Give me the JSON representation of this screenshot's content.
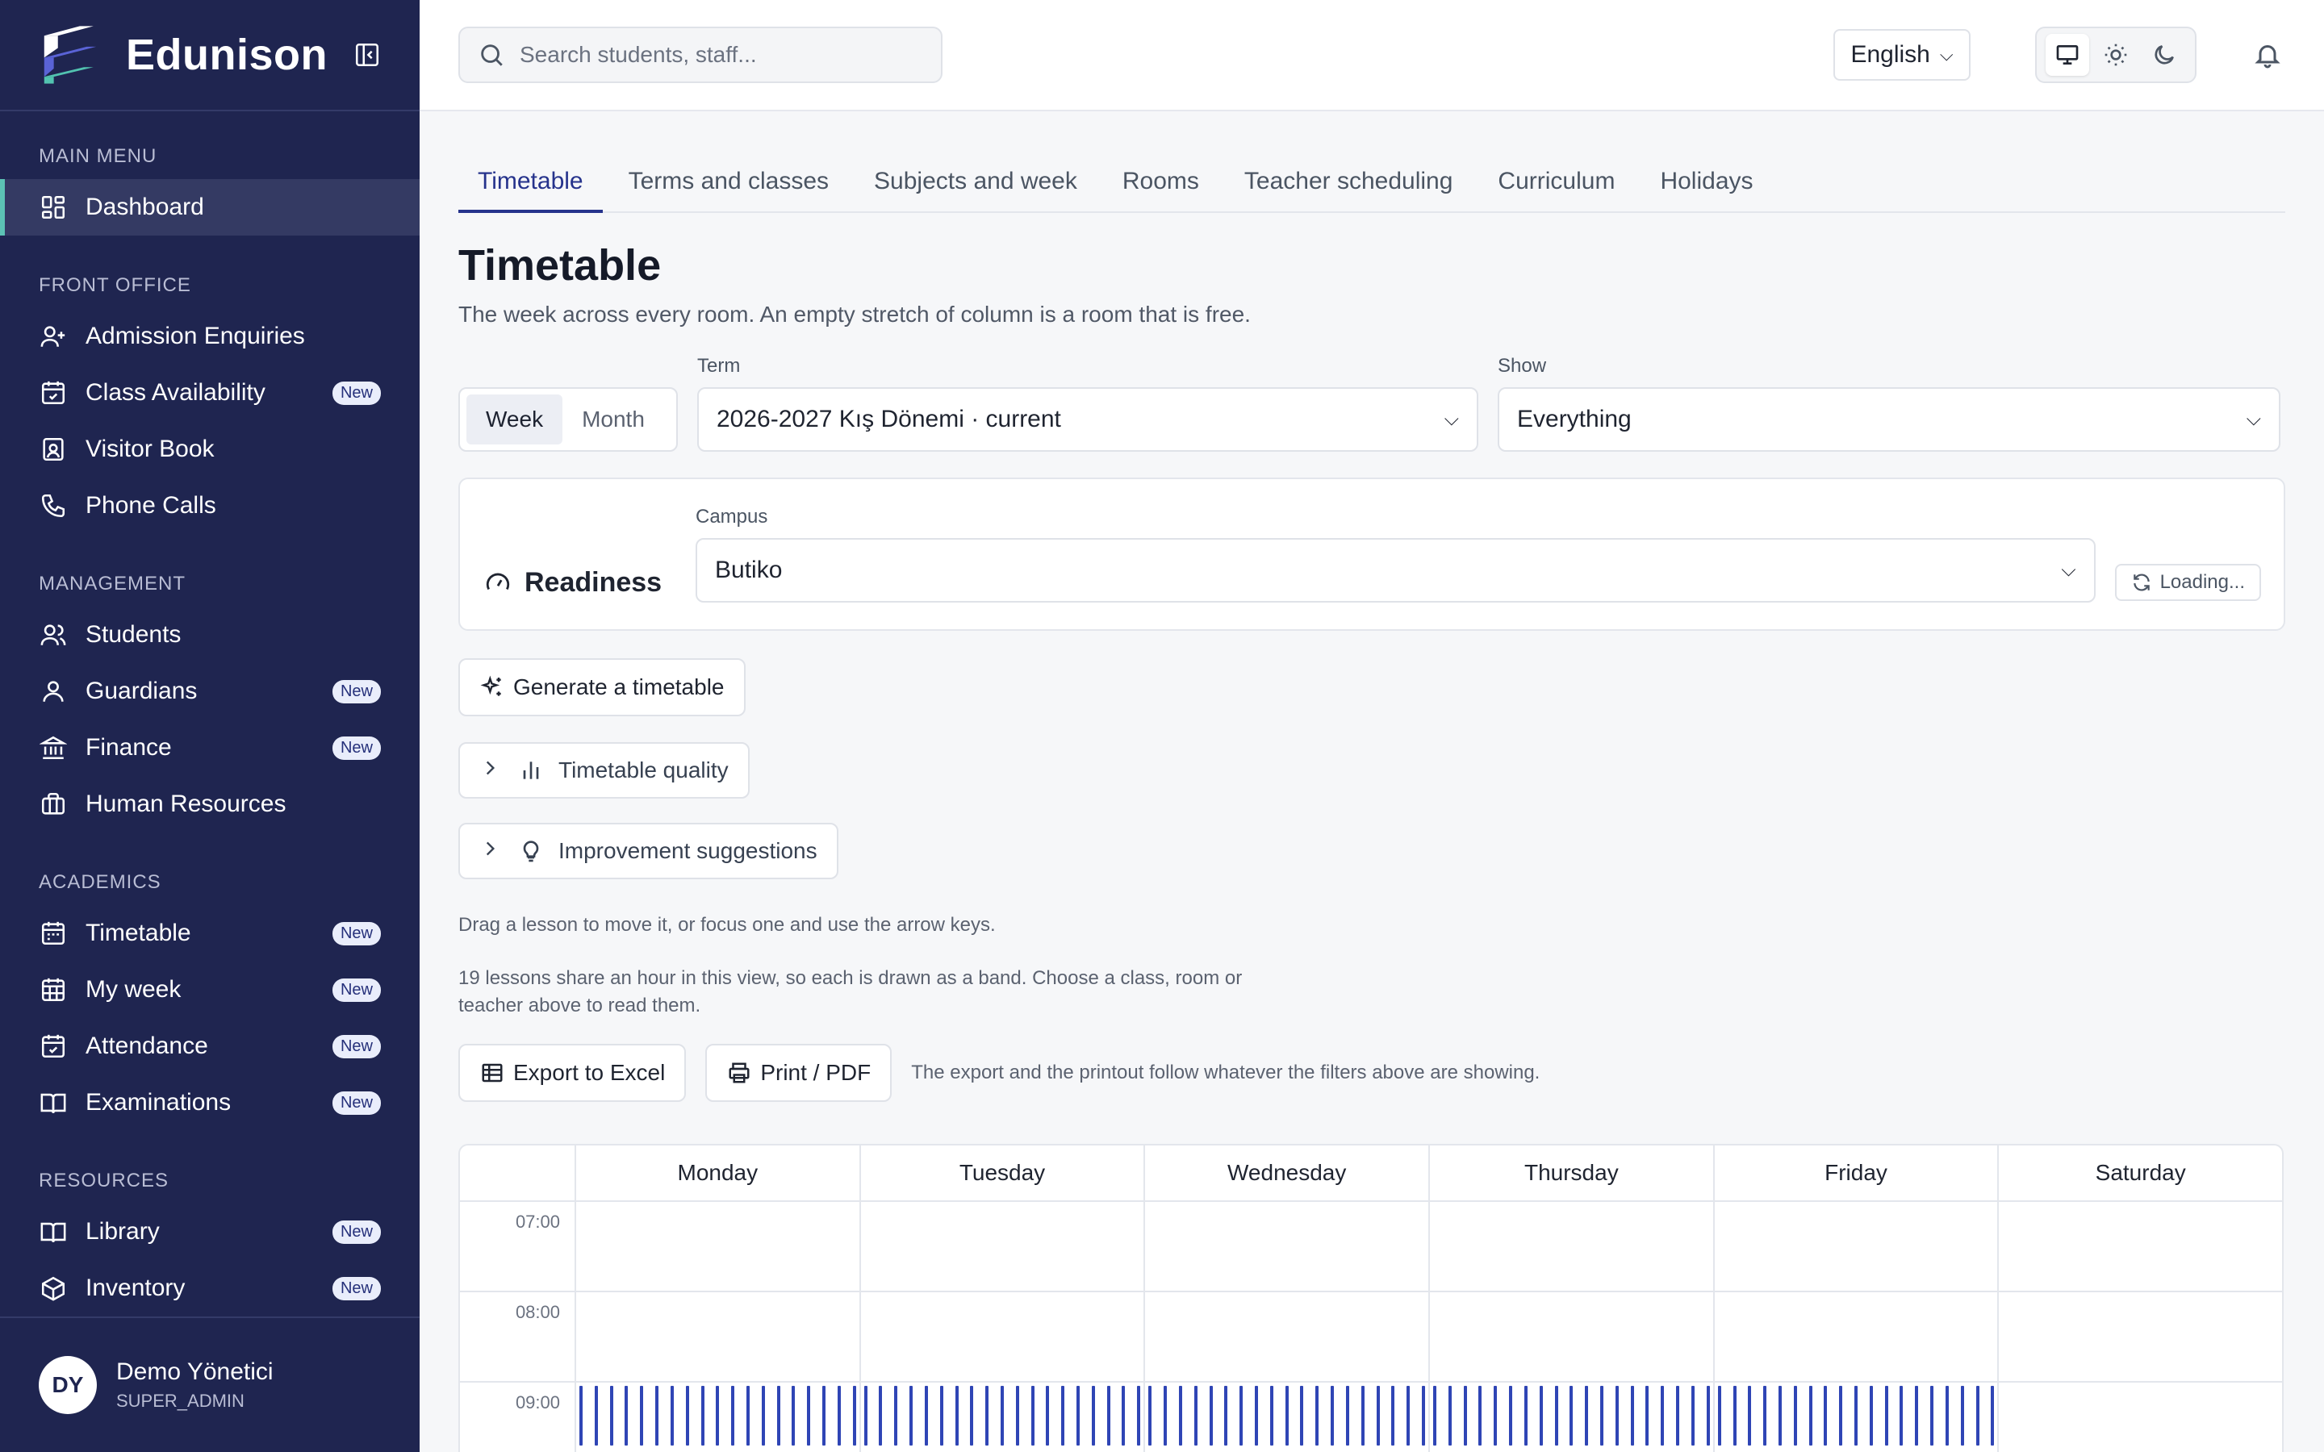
{
  "brand": {
    "name": "Edunison"
  },
  "sidebar": {
    "sections": [
      {
        "title": "MAIN MENU",
        "items": [
          {
            "label": "Dashboard",
            "icon": "dashboard-icon",
            "active": true
          }
        ]
      },
      {
        "title": "FRONT OFFICE",
        "items": [
          {
            "label": "Admission Enquiries",
            "icon": "user-plus-icon"
          },
          {
            "label": "Class Availability",
            "icon": "calendar-check-icon",
            "badge": "New"
          },
          {
            "label": "Visitor Book",
            "icon": "id-badge-icon"
          },
          {
            "label": "Phone Calls",
            "icon": "phone-icon"
          }
        ]
      },
      {
        "title": "MANAGEMENT",
        "items": [
          {
            "label": "Students",
            "icon": "users-icon"
          },
          {
            "label": "Guardians",
            "icon": "user-icon",
            "badge": "New"
          },
          {
            "label": "Finance",
            "icon": "bank-icon",
            "badge": "New"
          },
          {
            "label": "Human Resources",
            "icon": "briefcase-icon"
          }
        ]
      },
      {
        "title": "ACADEMICS",
        "items": [
          {
            "label": "Timetable",
            "icon": "calendar-icon",
            "badge": "New"
          },
          {
            "label": "My week",
            "icon": "calendar-grid-icon",
            "badge": "New"
          },
          {
            "label": "Attendance",
            "icon": "calendar-check-icon",
            "badge": "New"
          },
          {
            "label": "Examinations",
            "icon": "book-open-icon",
            "badge": "New"
          }
        ]
      },
      {
        "title": "RESOURCES",
        "items": [
          {
            "label": "Library",
            "icon": "book-open-icon",
            "badge": "New"
          },
          {
            "label": "Inventory",
            "icon": "box-icon",
            "badge": "New"
          }
        ]
      }
    ],
    "user": {
      "initials": "DY",
      "name": "Demo Yönetici",
      "role": "SUPER_ADMIN"
    }
  },
  "topbar": {
    "search_placeholder": "Search students, staff...",
    "language": "English"
  },
  "tabs": [
    "Timetable",
    "Terms and classes",
    "Subjects and week",
    "Rooms",
    "Teacher scheduling",
    "Curriculum",
    "Holidays"
  ],
  "page": {
    "title": "Timetable",
    "subtitle": "The week across every room. An empty stretch of column is a room that is free."
  },
  "filters": {
    "view_week": "Week",
    "view_month": "Month",
    "term_label": "Term",
    "term_value": "2026-2027 Kış Dönemi · current",
    "show_label": "Show",
    "show_value": "Everything"
  },
  "readiness": {
    "title": "Readiness",
    "campus_label": "Campus",
    "campus_value": "Butiko",
    "loading": "Loading..."
  },
  "actions": {
    "generate": "Generate a timetable",
    "quality": "Timetable quality",
    "suggestions": "Improvement suggestions"
  },
  "hints": {
    "drag": "Drag a lesson to move it, or focus one and use the arrow keys.",
    "bands_line1": "19 lessons share an hour in this view, so each is drawn as a band. Choose a class, room or",
    "bands_line2": "teacher above to read them."
  },
  "export": {
    "excel": "Export to Excel",
    "print": "Print / PDF",
    "note": "The export and the printout follow whatever the filters above are showing."
  },
  "timetable": {
    "days": [
      "Monday",
      "Tuesday",
      "Wednesday",
      "Thursday",
      "Friday",
      "Saturday"
    ],
    "hours": [
      "07:00",
      "08:00",
      "09:00"
    ],
    "band_hour": "09:00",
    "band_count_per_day": 19,
    "band_days": [
      "Monday",
      "Tuesday",
      "Wednesday",
      "Thursday",
      "Friday"
    ],
    "band_color": "#2f45b5"
  },
  "colors": {
    "sidebar": "#1f2550",
    "accent": "#26338c",
    "active_marker": "#5cc2b4"
  }
}
